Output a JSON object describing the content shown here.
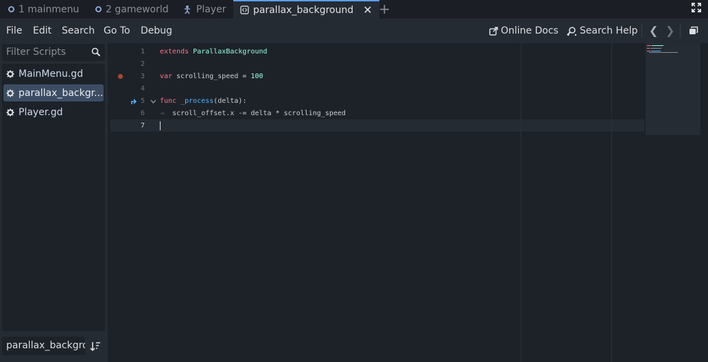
{
  "tabs": [
    {
      "label": "1 mainmenu",
      "icon": "ring-icon"
    },
    {
      "label": "2 gameworld",
      "icon": "ring-icon"
    },
    {
      "label": "Player",
      "icon": "player-icon"
    },
    {
      "label": "parallax_background",
      "icon": "script-icon",
      "active": true
    }
  ],
  "menu": [
    "File",
    "Edit",
    "Search",
    "Go To",
    "Debug"
  ],
  "toolbar": {
    "online_docs": "Online Docs",
    "search_help": "Search Help"
  },
  "filter": {
    "placeholder": "Filter Scripts"
  },
  "scripts": [
    {
      "label": "MainMenu.gd",
      "selected": false
    },
    {
      "label": "parallax_backgr...",
      "selected": true
    },
    {
      "label": "Player.gd",
      "selected": false
    }
  ],
  "bottom_field": "parallax_backgro",
  "code": {
    "line_numbers": [
      "1",
      "2",
      "3",
      "4",
      "5",
      "6",
      "7"
    ],
    "l1_kw": "extends",
    "l1_type": "ParallaxBackground",
    "l3_kw": "var",
    "l3_rest": " scrolling_speed = ",
    "l3_num": "100",
    "l5_kw": "func",
    "l5_fn": "_process",
    "l5_rest": "(delta):",
    "l6_tab": "⇥",
    "l6_text": "scroll_offset.x -= delta * scrolling_speed"
  },
  "colors": {
    "accent": "#5a9ef0",
    "keyword": "#ff7085",
    "type": "#8fffdb",
    "number": "#a1ffe0",
    "breakpoint": "#b0462f"
  }
}
